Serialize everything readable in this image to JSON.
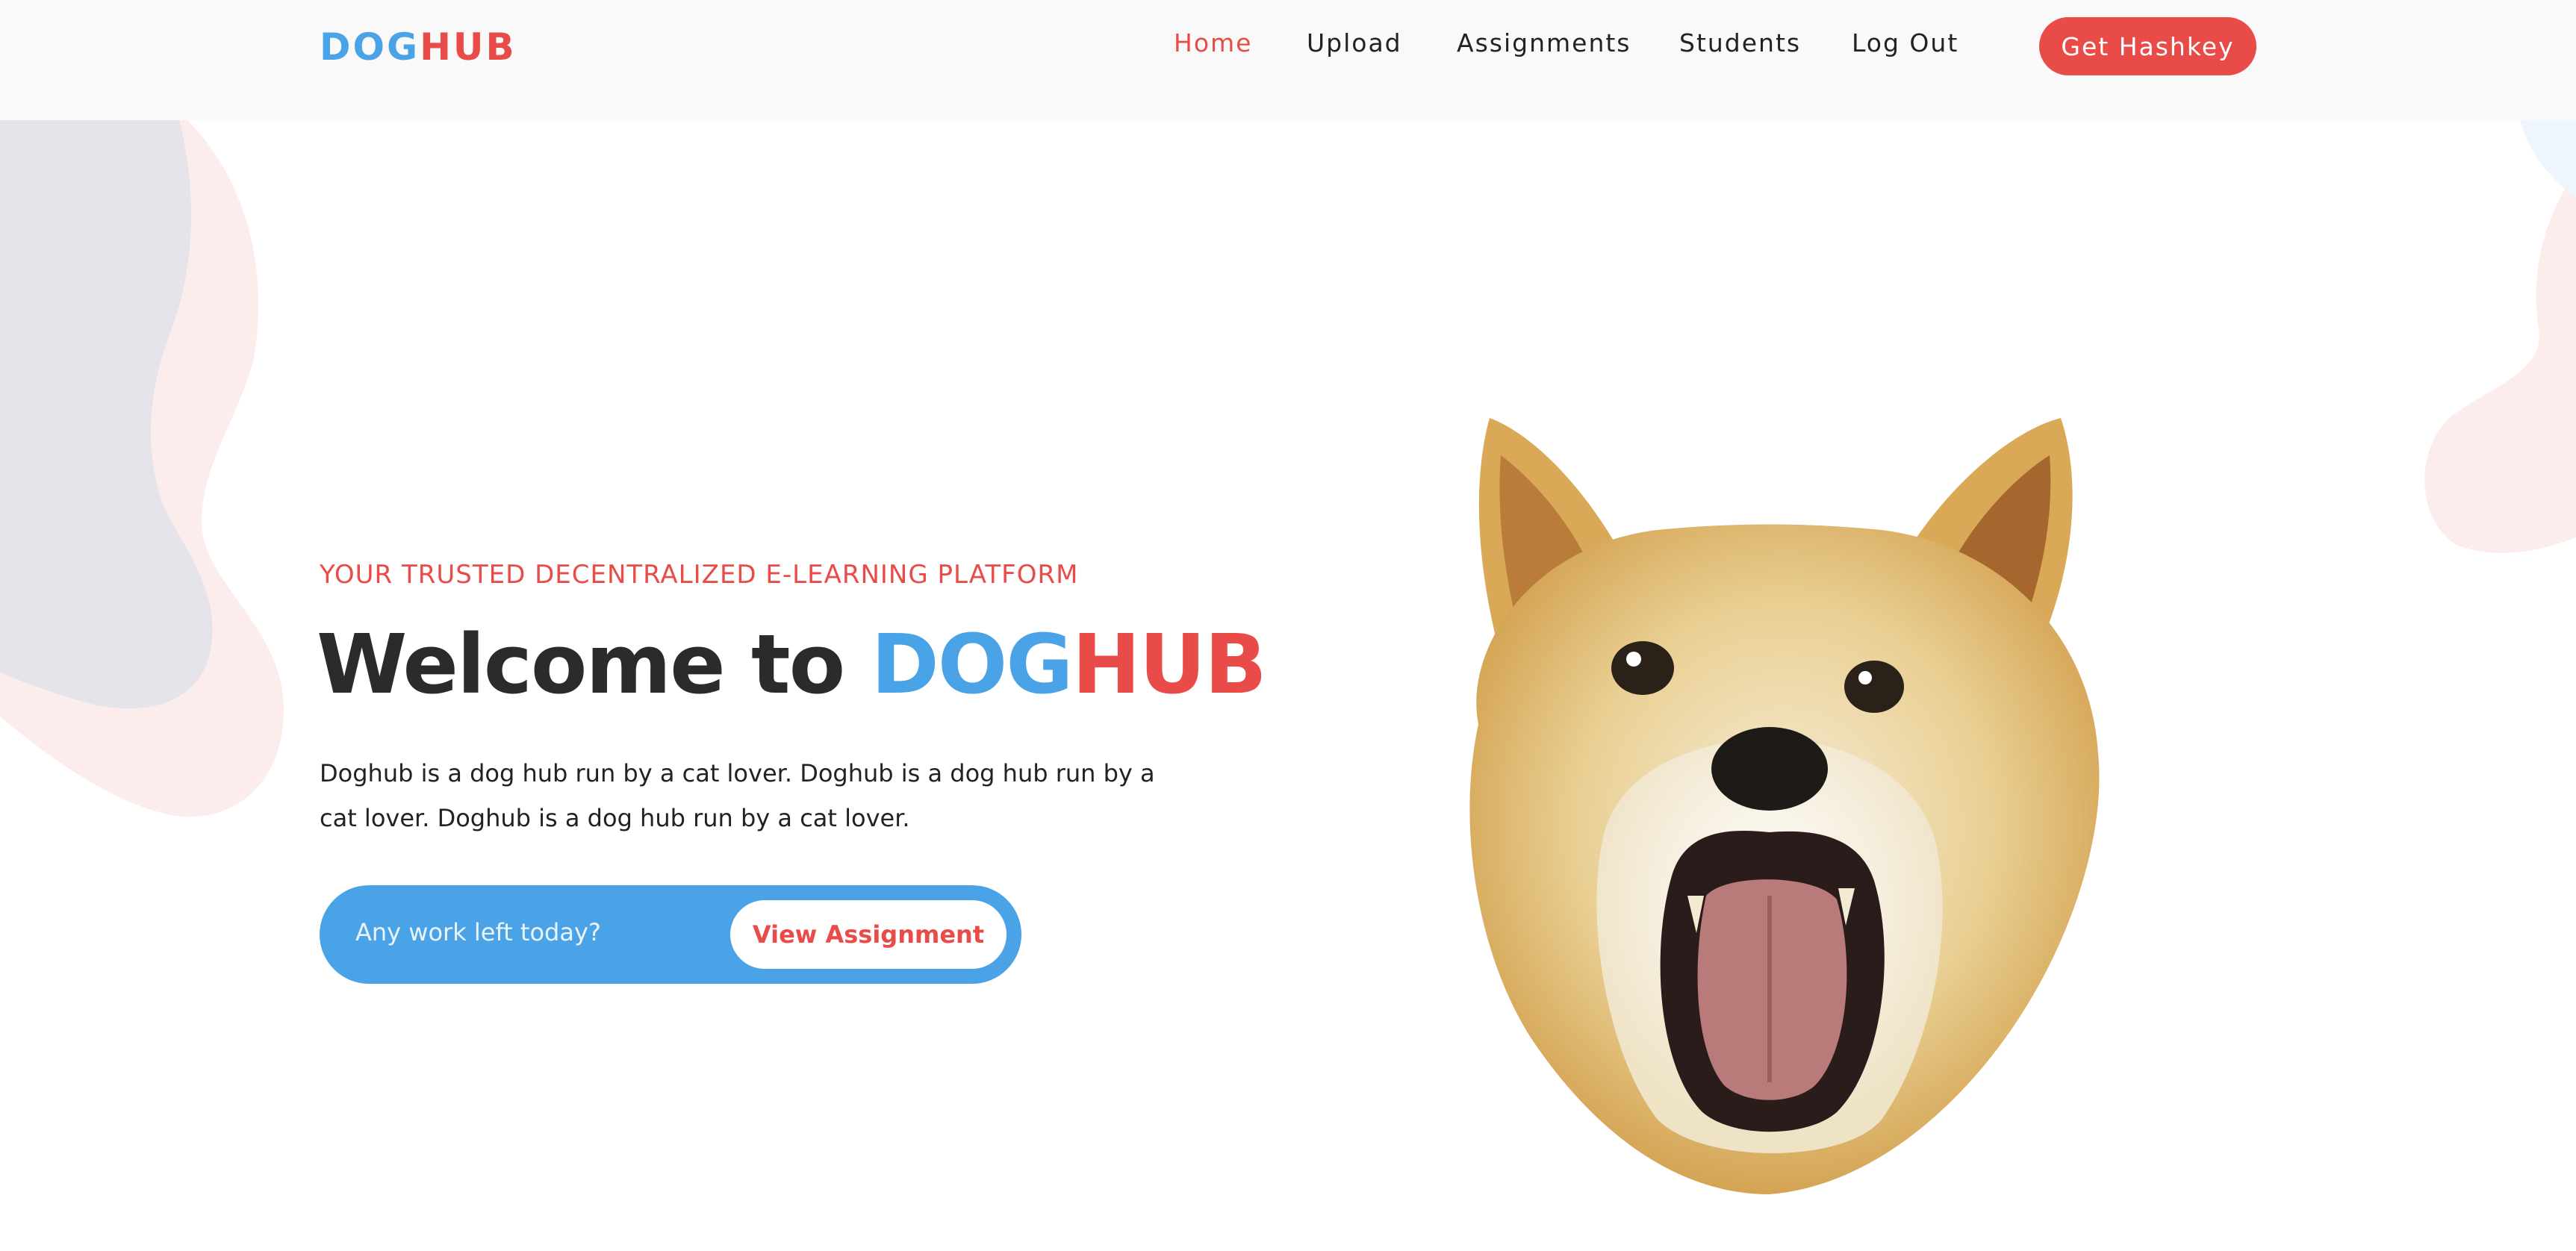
{
  "brand": {
    "part1": "DOG",
    "part2": "HUB"
  },
  "nav": [
    {
      "label": "Home",
      "active": true
    },
    {
      "label": "Upload",
      "active": false
    },
    {
      "label": "Assignments",
      "active": false
    },
    {
      "label": "Students",
      "active": false
    },
    {
      "label": "Log Out",
      "active": false
    }
  ],
  "header": {
    "cta_label": "Get Hashkey"
  },
  "hero": {
    "tagline": "YOUR TRUSTED DECENTRALIZED E-LEARNING PLATFORM",
    "title_prefix": "Welcome to ",
    "title_brand_part1": "DOG",
    "title_brand_part2": "HUB",
    "description": "Doghub is a dog hub run by a cat lover. Doghub is a dog hub run by a cat lover. Doghub is a dog hub run by a cat lover.",
    "input_placeholder": "Any work left today?",
    "button_label": "View Assignment",
    "image_icon": "shiba-dog-face"
  },
  "colors": {
    "brand_blue": "#4aa3e6",
    "brand_red": "#e94b48",
    "header_bg": "#f9f9f9",
    "text_dark": "#2b2b2b"
  }
}
